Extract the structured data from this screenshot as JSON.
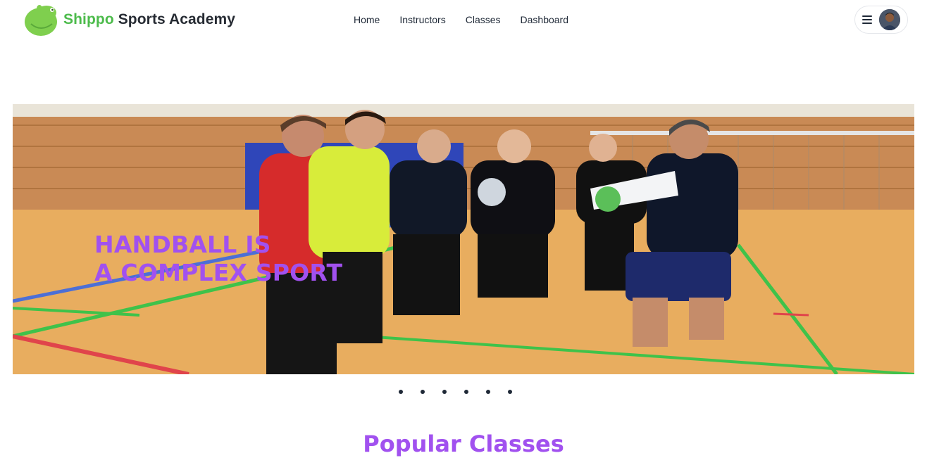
{
  "brand": {
    "name_accent": "Shippo",
    "name_rest": "Sports Academy",
    "logo_icon": "hippo-logo-icon",
    "accent_color": "#4cbb4b"
  },
  "nav": {
    "links": [
      "Home",
      "Instructors",
      "Classes",
      "Dashboard"
    ]
  },
  "user_menu": {
    "menu_icon": "hamburger-icon",
    "avatar_icon": "user-avatar"
  },
  "hero": {
    "slides_count": 6,
    "active_slide": 1,
    "caption_line1": "HANDBALL IS",
    "caption_line2": "A COMPLEX SPORT",
    "caption_color": "#a151ef"
  },
  "popular_classes": {
    "title": "Popular Classes",
    "title_color": "#a151ef"
  }
}
